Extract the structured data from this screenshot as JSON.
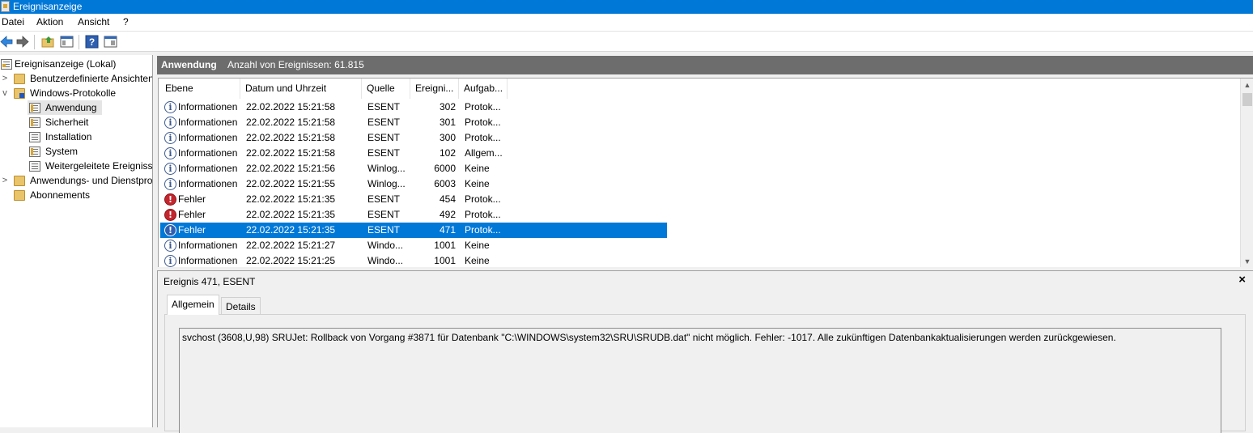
{
  "window": {
    "title": "Ereignisanzeige"
  },
  "menu": [
    "Datei",
    "Aktion",
    "Ansicht",
    "?"
  ],
  "toolbar": {
    "icons": [
      "back-arrow-icon",
      "forward-arrow-icon",
      "folder-up-icon",
      "show-hide-tree-icon",
      "help-icon",
      "show-hide-action-pane-icon"
    ]
  },
  "tree": {
    "root": "Ereignisanzeige (Lokal)",
    "items": [
      {
        "label": "Benutzerdefinierte Ansichten",
        "expand": ">"
      },
      {
        "label": "Windows-Protokolle",
        "expand": "v"
      },
      {
        "label": "Anwendung"
      },
      {
        "label": "Sicherheit"
      },
      {
        "label": "Installation"
      },
      {
        "label": "System"
      },
      {
        "label": "Weitergeleitete Ereignisse"
      },
      {
        "label": "Anwendungs- und Dienstprotokolle",
        "expand": ">"
      },
      {
        "label": "Abonnements"
      }
    ]
  },
  "main": {
    "log_name": "Anwendung",
    "event_count": "Anzahl von Ereignissen: 61.815"
  },
  "table": {
    "columns": [
      "Ebene",
      "Datum und Uhrzeit",
      "Quelle",
      "Ereigni...",
      "Aufgab..."
    ],
    "rows": [
      {
        "level": "Informationen",
        "type": "info",
        "date": "22.02.2022 15:21:58",
        "source": "ESENT",
        "id": "302",
        "task": "Protok..."
      },
      {
        "level": "Informationen",
        "type": "info",
        "date": "22.02.2022 15:21:58",
        "source": "ESENT",
        "id": "301",
        "task": "Protok..."
      },
      {
        "level": "Informationen",
        "type": "info",
        "date": "22.02.2022 15:21:58",
        "source": "ESENT",
        "id": "300",
        "task": "Protok..."
      },
      {
        "level": "Informationen",
        "type": "info",
        "date": "22.02.2022 15:21:58",
        "source": "ESENT",
        "id": "102",
        "task": "Allgem..."
      },
      {
        "level": "Informationen",
        "type": "info",
        "date": "22.02.2022 15:21:56",
        "source": "Winlog...",
        "id": "6000",
        "task": "Keine"
      },
      {
        "level": "Informationen",
        "type": "info",
        "date": "22.02.2022 15:21:55",
        "source": "Winlog...",
        "id": "6003",
        "task": "Keine"
      },
      {
        "level": "Fehler",
        "type": "error",
        "date": "22.02.2022 15:21:35",
        "source": "ESENT",
        "id": "454",
        "task": "Protok..."
      },
      {
        "level": "Fehler",
        "type": "error",
        "date": "22.02.2022 15:21:35",
        "source": "ESENT",
        "id": "492",
        "task": "Protok..."
      },
      {
        "level": "Fehler",
        "type": "error",
        "date": "22.02.2022 15:21:35",
        "source": "ESENT",
        "id": "471",
        "task": "Protok...",
        "selected": true
      },
      {
        "level": "Informationen",
        "type": "info",
        "date": "22.02.2022 15:21:27",
        "source": "Windo...",
        "id": "1001",
        "task": "Keine"
      },
      {
        "level": "Informationen",
        "type": "info",
        "date": "22.02.2022 15:21:25",
        "source": "Windo...",
        "id": "1001",
        "task": "Keine"
      }
    ]
  },
  "detail": {
    "title": "Ereignis 471, ESENT",
    "close": "×",
    "tabs": [
      "Allgemein",
      "Details"
    ],
    "message": "svchost (3608,U,98) SRUJet: Rollback von Vorgang #3871 für Datenbank \"C:\\WINDOWS\\system32\\SRU\\SRUDB.dat\" nicht möglich. Fehler: -1017. Alle zukünftigen Datenbankaktualisierungen werden zurückgewiesen."
  },
  "colors": {
    "accent": "#0078d7",
    "header_bar": "#6d6d6d",
    "error": "#c4262e"
  }
}
